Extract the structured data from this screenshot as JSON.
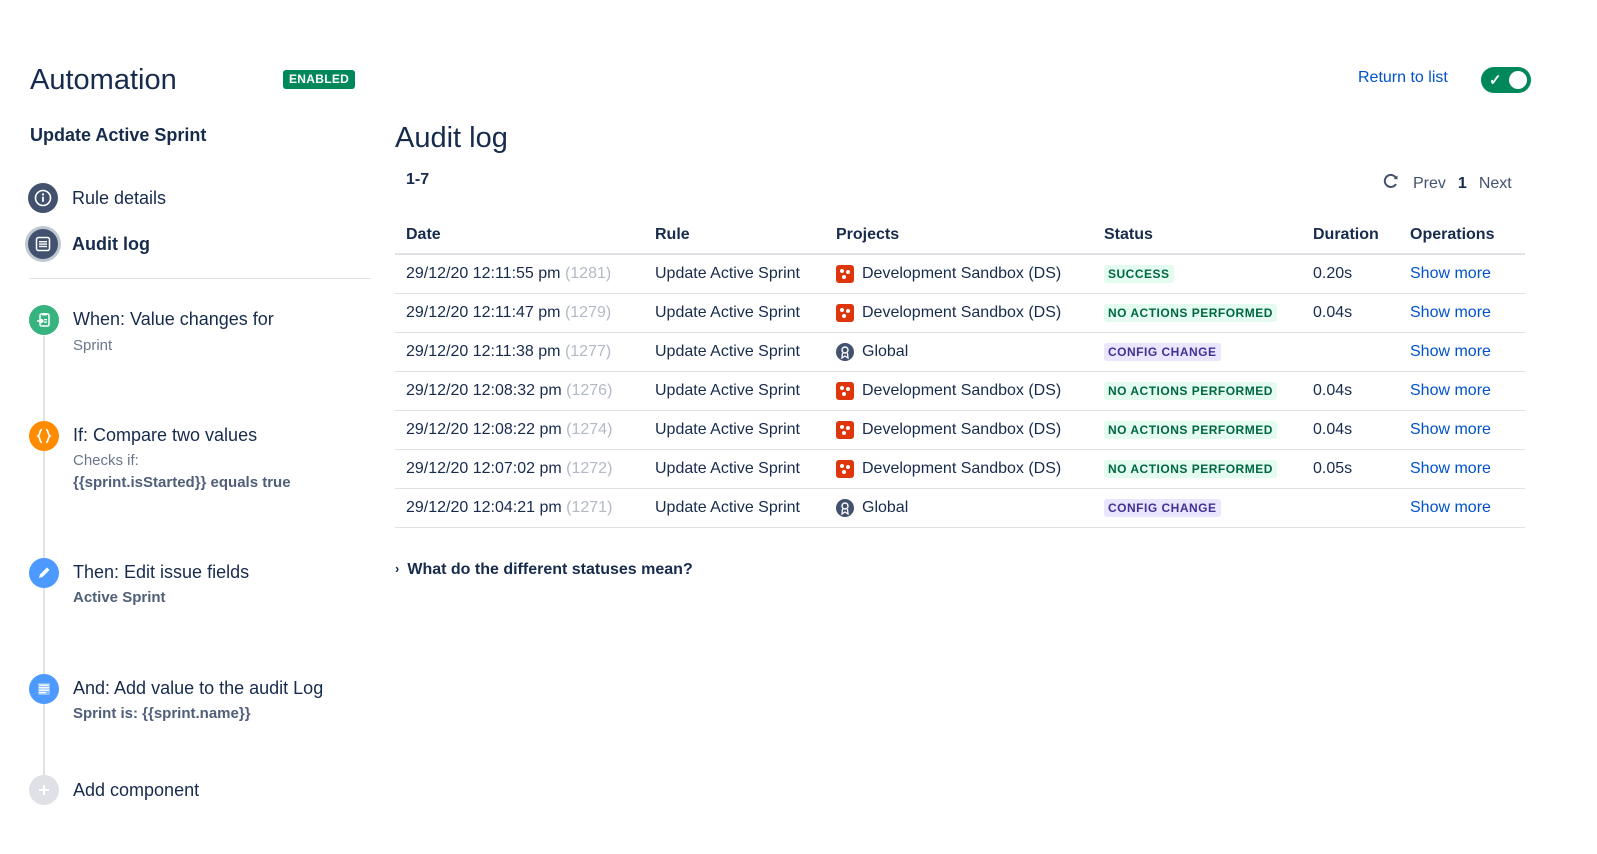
{
  "header": {
    "app_title": "Automation",
    "status_badge": "ENABLED",
    "return_link": "Return to list",
    "toggle_on": true,
    "colors": {
      "enabled": "#00875a",
      "link": "#0052cc"
    }
  },
  "sidebar": {
    "rule_name": "Update Active Sprint",
    "nav": [
      {
        "label": "Rule details",
        "icon": "info-icon",
        "active": false
      },
      {
        "label": "Audit log",
        "icon": "list-icon",
        "active": true
      }
    ],
    "steps": [
      {
        "icon": "trigger-icon",
        "color": "#36b37e",
        "title": "When: Value changes for",
        "sub": "Sprint"
      },
      {
        "icon": "braces-icon",
        "color": "#ff8b00",
        "title": "If: Compare two values",
        "sub": "Checks if:",
        "bold": "{{sprint.isStarted}} equals true"
      },
      {
        "icon": "pencil-icon",
        "color": "#4c9aff",
        "title": "Then: Edit issue fields",
        "bold": "Active Sprint"
      },
      {
        "icon": "document-icon",
        "color": "#4c9aff",
        "title": "And: Add value to the audit Log",
        "bold": "Sprint is: {{sprint.name}}"
      },
      {
        "icon": "plus-icon",
        "color": "#c1c7d0",
        "title": "Add component"
      }
    ]
  },
  "main": {
    "title": "Audit log",
    "range": "1-7",
    "pager": {
      "prev": "Prev",
      "current": "1",
      "next": "Next"
    },
    "columns": [
      "Date",
      "Rule",
      "Projects",
      "Status",
      "Duration",
      "Operations"
    ],
    "rows": [
      {
        "date": "29/12/20 12:11:55 pm",
        "id": "(1281)",
        "rule": "Update Active Sprint",
        "project": "Development Sandbox (DS)",
        "project_type": "sandbox",
        "status": "SUCCESS",
        "status_type": "success",
        "duration": "0.20s",
        "op": "Show more"
      },
      {
        "date": "29/12/20 12:11:47 pm",
        "id": "(1279)",
        "rule": "Update Active Sprint",
        "project": "Development Sandbox (DS)",
        "project_type": "sandbox",
        "status": "NO ACTIONS PERFORMED",
        "status_type": "noaction",
        "duration": "0.04s",
        "op": "Show more"
      },
      {
        "date": "29/12/20 12:11:38 pm",
        "id": "(1277)",
        "rule": "Update Active Sprint",
        "project": "Global",
        "project_type": "global",
        "status": "CONFIG CHANGE",
        "status_type": "config",
        "duration": "",
        "op": "Show more"
      },
      {
        "date": "29/12/20 12:08:32 pm",
        "id": "(1276)",
        "rule": "Update Active Sprint",
        "project": "Development Sandbox (DS)",
        "project_type": "sandbox",
        "status": "NO ACTIONS PERFORMED",
        "status_type": "noaction",
        "duration": "0.04s",
        "op": "Show more"
      },
      {
        "date": "29/12/20 12:08:22 pm",
        "id": "(1274)",
        "rule": "Update Active Sprint",
        "project": "Development Sandbox (DS)",
        "project_type": "sandbox",
        "status": "NO ACTIONS PERFORMED",
        "status_type": "noaction",
        "duration": "0.04s",
        "op": "Show more"
      },
      {
        "date": "29/12/20 12:07:02 pm",
        "id": "(1272)",
        "rule": "Update Active Sprint",
        "project": "Development Sandbox (DS)",
        "project_type": "sandbox",
        "status": "NO ACTIONS PERFORMED",
        "status_type": "noaction",
        "duration": "0.05s",
        "op": "Show more"
      },
      {
        "date": "29/12/20 12:04:21 pm",
        "id": "(1271)",
        "rule": "Update Active Sprint",
        "project": "Global",
        "project_type": "global",
        "status": "CONFIG CHANGE",
        "status_type": "config",
        "duration": "",
        "op": "Show more"
      }
    ],
    "status_colors": {
      "success": {
        "bg": "#e3fcef",
        "fg": "#006644"
      },
      "noaction": {
        "bg": "#e3fcef",
        "fg": "#006644"
      },
      "config": {
        "bg": "#eae6ff",
        "fg": "#403294"
      }
    },
    "faq": "What do the different statuses mean?"
  }
}
